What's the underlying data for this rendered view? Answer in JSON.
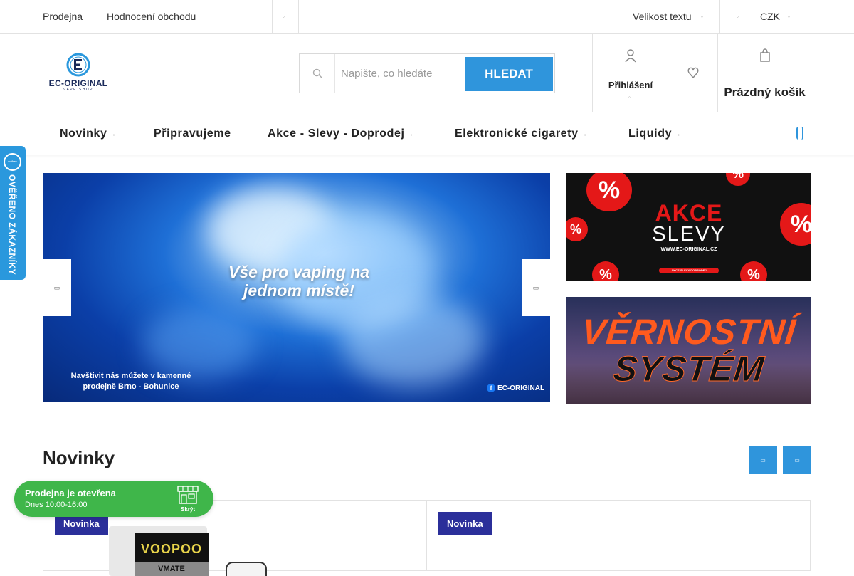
{
  "topbar": {
    "links": [
      "Prodejna",
      "Hodnocení obchodu"
    ],
    "more_icon": "chevron-down-icon",
    "text_size_label": "Velikost textu",
    "currency": "CZK"
  },
  "header": {
    "logo_text": "EC-ORIGINAL",
    "logo_subtext": "VAPE SHOP",
    "search": {
      "placeholder": "Napište, co hledáte",
      "button_label": "HLEDAT"
    },
    "login_label": "Přihlášení",
    "cart_label": "Prázdný košík"
  },
  "nav": {
    "items": [
      {
        "label": "Novinky"
      },
      {
        "label": "Připravujeme"
      },
      {
        "label": "Akce - Slevy - Doprodej"
      },
      {
        "label": "Elektronické cigarety"
      },
      {
        "label": "Liquidy"
      }
    ]
  },
  "banner": {
    "headline_line1": "Vše pro vaping na",
    "headline_line2": "jednom místě!",
    "visit_line1": "Navštivit nás můžete v kamenné",
    "visit_line2": "prodejně Brno - Bohunice",
    "brand": "EC-ORIGINAL"
  },
  "promo1": {
    "line1": "AKCE",
    "line2": "SLEVY",
    "url": "WWW.EC-ORIGINAL.CZ",
    "button": "AKCE-SLEVY-DOPRODEJ",
    "badge_symbol": "%"
  },
  "promo2": {
    "line1": "VĚRNOSTNÍ",
    "line2": "SYSTÉM"
  },
  "section": {
    "title": "Novinky"
  },
  "products": [
    {
      "badge": "Novinka",
      "brand": "VOOPOO",
      "model": "VMATE"
    },
    {
      "badge": "Novinka"
    }
  ],
  "verified_tab": {
    "label": "OVĚŘENO ZÁKAZNÍKY",
    "badge_text": "OVĚŘENO ZÁKAZNÍKY"
  },
  "store_status": {
    "title": "Prodejna je otevřena",
    "hours": "Dnes 10:00-16:00",
    "hide_label": "Skrýt"
  },
  "colors": {
    "accent": "#2f95dc",
    "tag": "#2b2f9a",
    "open_green": "#3fb64a"
  }
}
